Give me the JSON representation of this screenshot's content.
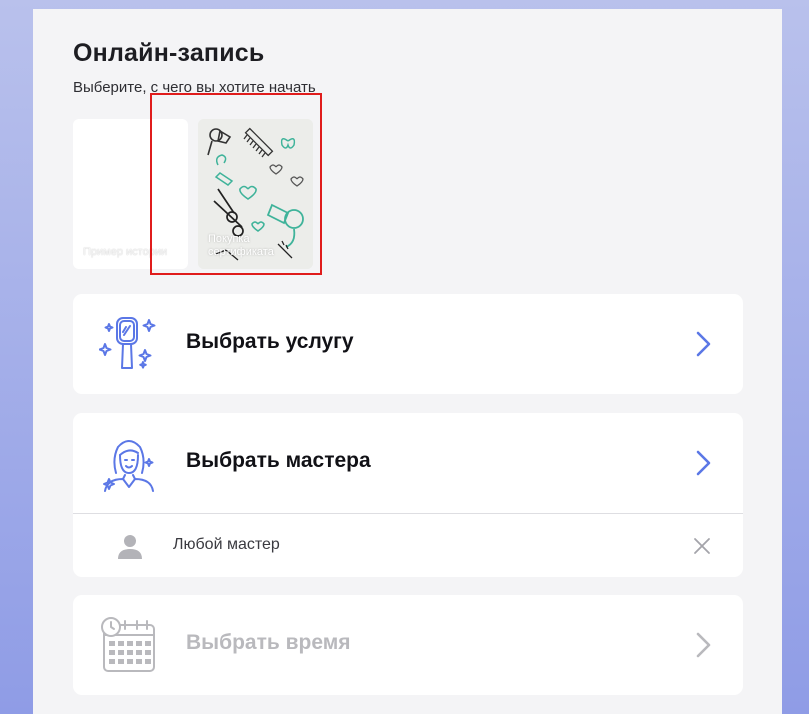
{
  "header": {
    "title": "Онлайн-запись",
    "subtitle": "Выберите, с чего вы хотите начать"
  },
  "stories": [
    {
      "caption": "Пример истории"
    },
    {
      "caption": "Покупка сертификата"
    }
  ],
  "steps": {
    "service": {
      "label": "Выбрать услугу",
      "icon": "hand-mirror-icon",
      "enabled": true
    },
    "master": {
      "label": "Выбрать мастера",
      "icon": "woman-master-icon",
      "enabled": true,
      "selected": "Любой мастер"
    },
    "time": {
      "label": "Выбрать время",
      "icon": "calendar-clock-icon",
      "enabled": false
    }
  },
  "colors": {
    "accent": "#5b77e6",
    "highlight": "#e01c1c",
    "disabled_text": "#b9b9bd",
    "background_top": "#b9c1ec",
    "background_bottom": "#8f9ce6"
  }
}
